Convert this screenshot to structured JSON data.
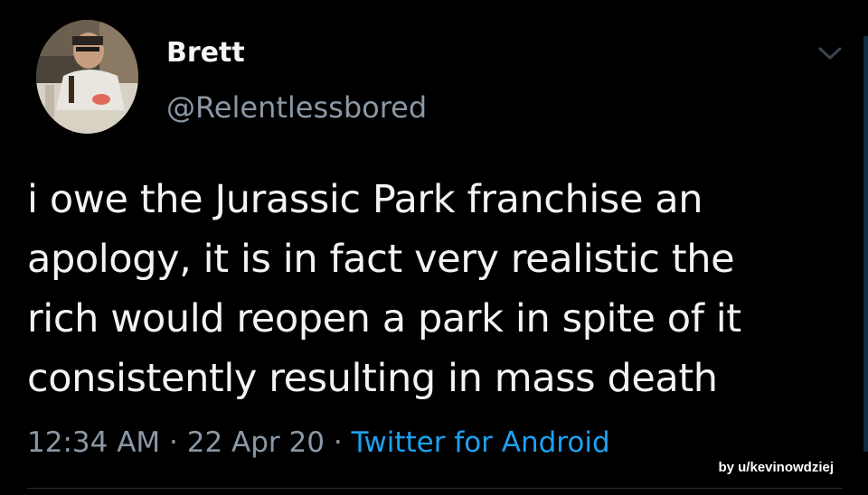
{
  "user": {
    "display_name": "Brett",
    "handle": "@Relentlessbored",
    "avatar_icon": "profile-photo"
  },
  "tweet": {
    "text": "i owe the Jurassic Park franchise an\napology, it is in fact very realistic the\nrich would reopen a park in spite of it\nconsistently resulting in mass death",
    "time": "12:34 AM",
    "separator": "·",
    "date": "22 Apr 20",
    "source": "Twitter for Android"
  },
  "credit": "by u/kevinowdziej",
  "colors": {
    "background": "#000000",
    "text": "#f3f3f3",
    "muted": "#8b98a5",
    "link": "#1da1f2"
  }
}
